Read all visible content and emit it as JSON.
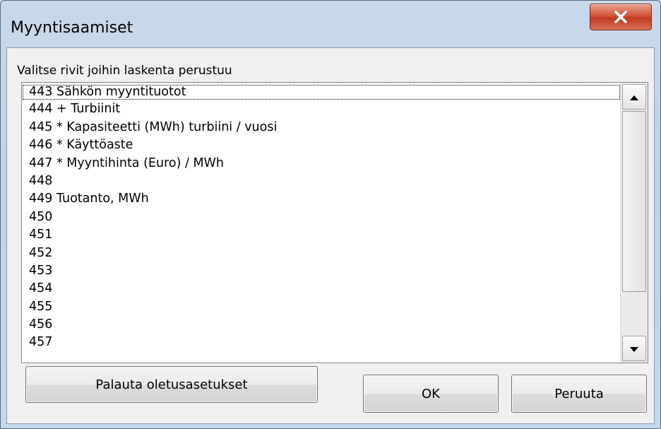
{
  "window": {
    "title": "Myyntisaamiset",
    "close_icon": "close-x-icon"
  },
  "instruction": "Valitse rivit joihin laskenta perustuu",
  "list": {
    "items": [
      "443 Sähkön myyntituotot",
      "444 + Turbiinit",
      "445 * Kapasiteetti (MWh) turbiini / vuosi",
      "446 * Käyttöaste",
      "447 * Myyntihinta (Euro) / MWh",
      "448",
      "449 Tuotanto, MWh",
      "450",
      "451",
      "452",
      "453",
      "454",
      "455",
      "456",
      "457"
    ],
    "focused_index": 0
  },
  "buttons": {
    "reset_label": "Palauta oletusasetukset",
    "ok_label": "OK",
    "cancel_label": "Peruuta"
  },
  "colors": {
    "close_button": "#c23a22",
    "frame": "#bfd2e6",
    "client": "#f0f0f0"
  }
}
